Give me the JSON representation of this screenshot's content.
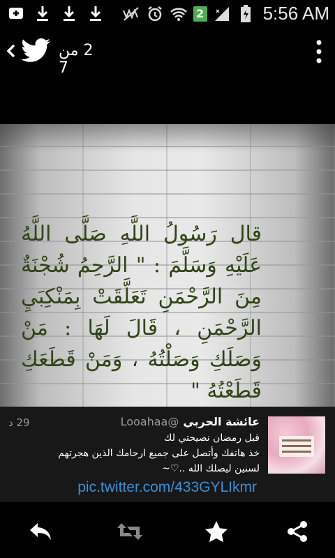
{
  "status_bar": {
    "time": "5:56 AM",
    "notification_count": "2",
    "icons": [
      "add-icon",
      "download-icon",
      "download-icon",
      "download-icon",
      "no-signal-icon",
      "alarm-icon",
      "wifi-icon",
      "signal-icon",
      "battery-icon"
    ]
  },
  "action_bar": {
    "counter": "2 من 7"
  },
  "image": {
    "quote": "قال رَسُولُ اللَّهِ صَلَّى اللَّهُ عَلَيْهِ وَسَلَّمَ : \" الرَّحِمُ شُجْنَةٌ مِنَ الرَّحْمَنِ تَعَلَّقَتْ بِمَنْكِبَيِ الرَّحْمَنِ ، قَالَ لَهَا : مَنْ وَصَلَكِ وَصَلْتُهُ ، وَمَنْ قَطَعَكِ قَطَعْتُهُ \""
  },
  "tweet": {
    "name": "عائشة الحربي",
    "handle": "@Looahaa",
    "time": "29 د",
    "line1": "قبل رمضان نصيحتي لك",
    "line2": "خذ هاتفك وأتصل على جميع ارحامك الذين هجرتهم",
    "line3": "لسنين ليصلك الله ..♡~",
    "link": "pic.twitter.com/433GYLIkmr"
  },
  "bottom_bar": {
    "icons": [
      "reply-icon",
      "retweet-icon",
      "favorite-icon",
      "share-icon"
    ]
  },
  "colors": {
    "link": "#3a8fd8",
    "quote_text": "#2f4417",
    "badge": "#4caf50"
  }
}
